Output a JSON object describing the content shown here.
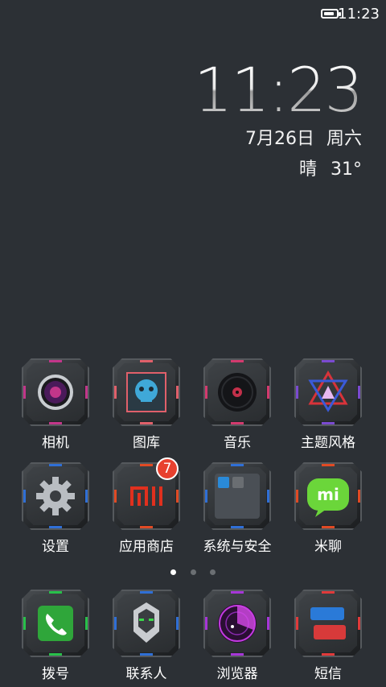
{
  "status_bar": {
    "time": "11:23",
    "battery_level": 0.85
  },
  "clock_widget": {
    "time": "11:23",
    "date": "7月26日",
    "weekday": "周六",
    "weather": "晴",
    "temperature": "31°"
  },
  "apps_row1": [
    {
      "label": "相机",
      "accent": "#c2368a"
    },
    {
      "label": "图库",
      "accent": "#e0606a"
    },
    {
      "label": "音乐",
      "accent": "#d23a6e"
    },
    {
      "label": "主题风格",
      "accent": "#7a4ad0"
    }
  ],
  "apps_row2": [
    {
      "label": "设置",
      "accent": "#2f6fd6"
    },
    {
      "label": "应用商店",
      "accent": "#e04a24",
      "badge": "7"
    },
    {
      "label": "系统与安全",
      "accent": "#2f6fd6"
    },
    {
      "label": "米聊",
      "accent": "#e04a24"
    }
  ],
  "dock": [
    {
      "label": "拨号",
      "accent": "#28c04a"
    },
    {
      "label": "联系人",
      "accent": "#2f6fd6"
    },
    {
      "label": "浏览器",
      "accent": "#a636d8"
    },
    {
      "label": "短信",
      "accent": "#e03a3a"
    }
  ],
  "pages": {
    "count": 3,
    "current": 1
  }
}
